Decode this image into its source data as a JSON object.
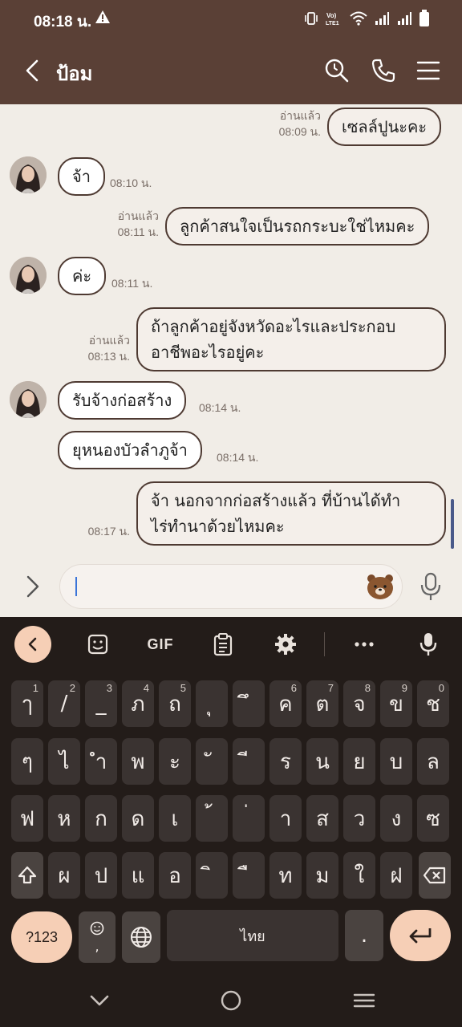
{
  "status_bar": {
    "time": "08:18 น."
  },
  "header": {
    "title": "ป้อม"
  },
  "messages": [
    {
      "dir": "out",
      "text": "เซลล์ปูนะคะ",
      "read": "อ่านแล้ว",
      "time": "08:09 น."
    },
    {
      "dir": "in",
      "text": "จ้า",
      "time": "08:10 น."
    },
    {
      "dir": "out",
      "text": "ลูกค้าสนใจเป็นรถกระบะใช่ไหมคะ",
      "read": "อ่านแล้ว",
      "time": "08:11 น."
    },
    {
      "dir": "in",
      "text": "ค่ะ",
      "time": "08:11 น."
    },
    {
      "dir": "out",
      "line1": "ถ้าลูกค้าอยู่จังหวัดอะไรและประกอบ",
      "line2": "อาชีพอะไรอยู่คะ",
      "read": "อ่านแล้ว",
      "time": "08:13 น."
    },
    {
      "dir": "in",
      "text": "รับจ้างก่อสร้าง",
      "time": "08:14 น."
    },
    {
      "dir": "in",
      "text": "ยุหนองบัวลำภูจ้า",
      "time": "08:14 น."
    },
    {
      "dir": "out",
      "line1": "จ้า นอกจากก่อสร้างแล้ว ที่บ้านได้ทำ",
      "line2": "ไร่ทำนาด้วยไหมคะ",
      "time": "08:17 น."
    }
  ],
  "input": {
    "value": ""
  },
  "keyboard": {
    "toolbar": {
      "gif_label": "GIF"
    },
    "row1": [
      "ๅ",
      "/",
      "_",
      "ภ",
      "ถ",
      "ุ",
      "ึ",
      "ค",
      "ต",
      "จ",
      "ข",
      "ช"
    ],
    "row1_hints": [
      "1",
      "2",
      "3",
      "4",
      "5",
      "",
      "",
      "6",
      "7",
      "8",
      "9",
      "0"
    ],
    "row2": [
      "ๆ",
      "ไ",
      "ำ",
      "พ",
      "ะ",
      "ั",
      "ี",
      "ร",
      "น",
      "ย",
      "บ",
      "ล"
    ],
    "row3": [
      "ฟ",
      "ห",
      "ก",
      "ด",
      "เ",
      "้",
      "่",
      "า",
      "ส",
      "ว",
      "ง",
      "ซ"
    ],
    "row4": [
      "ผ",
      "ป",
      "แ",
      "อ",
      "ิ",
      "ื",
      "ท",
      "ม",
      "ใ",
      "ฝ"
    ],
    "symbols_label": "?123",
    "emoji_comma_label": ",",
    "space_label": "ไทย",
    "period_label": "."
  },
  "colors": {
    "header": "#5a4036",
    "chat_bg": "#f1ede7",
    "keyboard_bg": "#231c19",
    "key": "#3a3331",
    "accent": "#f6cfb6"
  }
}
